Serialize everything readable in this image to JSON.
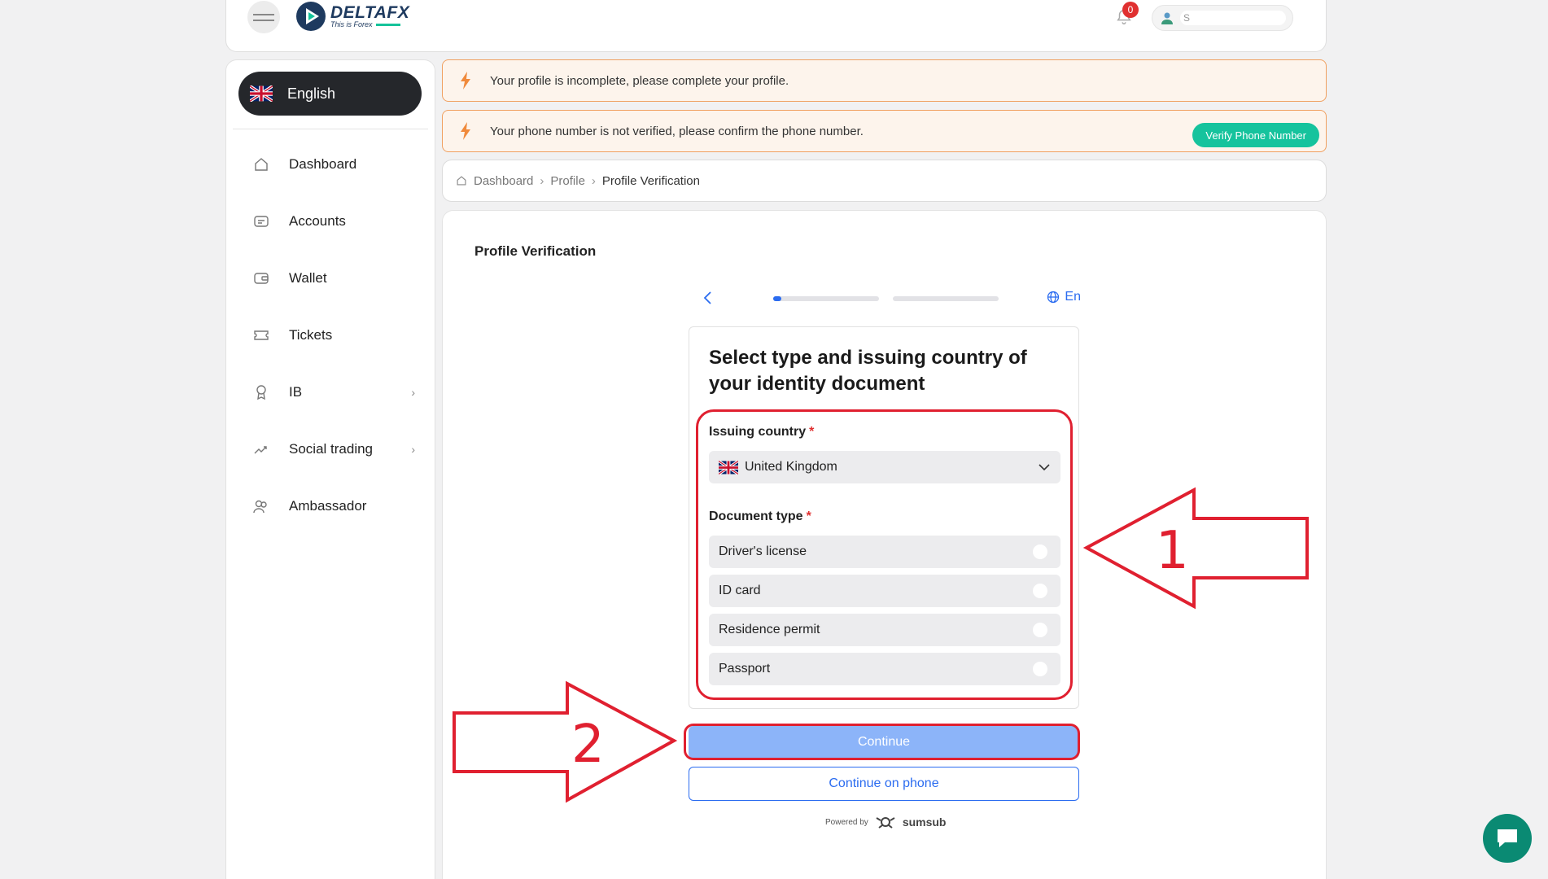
{
  "header": {
    "brand_name": "DELTAFX",
    "brand_tagline": "This is Forex",
    "notification_count": "0",
    "user_name": "S"
  },
  "sidebar": {
    "language": "English",
    "items": [
      {
        "label": "Dashboard",
        "icon": "home-icon"
      },
      {
        "label": "Accounts",
        "icon": "accounts-icon"
      },
      {
        "label": "Wallet",
        "icon": "wallet-icon"
      },
      {
        "label": "Tickets",
        "icon": "ticket-icon"
      },
      {
        "label": "IB",
        "icon": "award-icon",
        "chevron": "›"
      },
      {
        "label": "Social trading",
        "icon": "trend-icon",
        "chevron": "›"
      },
      {
        "label": "Ambassador",
        "icon": "users-icon"
      }
    ]
  },
  "alerts": {
    "profile": "Your profile is incomplete, please complete your profile.",
    "phone": "Your phone number is not verified, please confirm the phone number.",
    "verify_button": "Verify Phone Number"
  },
  "breadcrumb": {
    "items": [
      "Dashboard",
      "Profile",
      "Profile Verification"
    ],
    "separator": "›"
  },
  "main": {
    "title": "Profile Verification"
  },
  "sdk": {
    "language": "En",
    "progress_step": 1,
    "progress_total": 2,
    "heading": "Select type and issuing country of your identity document",
    "issuing_country_label": "Issuing country",
    "required_mark": "*",
    "country_value": "United Kingdom",
    "document_type_label": "Document type",
    "document_options": [
      "Driver's license",
      "ID card",
      "Residence permit",
      "Passport"
    ],
    "continue_label": "Continue",
    "continue_phone_label": "Continue on phone",
    "powered_by": "Powered by",
    "powered_brand": "sumsub"
  },
  "annotations": {
    "arrow_1": "1",
    "arrow_2": "2",
    "color": "#e02030"
  },
  "colors": {
    "accent_blue": "#2b6cf0",
    "green": "#16c39d",
    "alert_border": "#f0a060",
    "sidebar_dark": "#25272b"
  }
}
